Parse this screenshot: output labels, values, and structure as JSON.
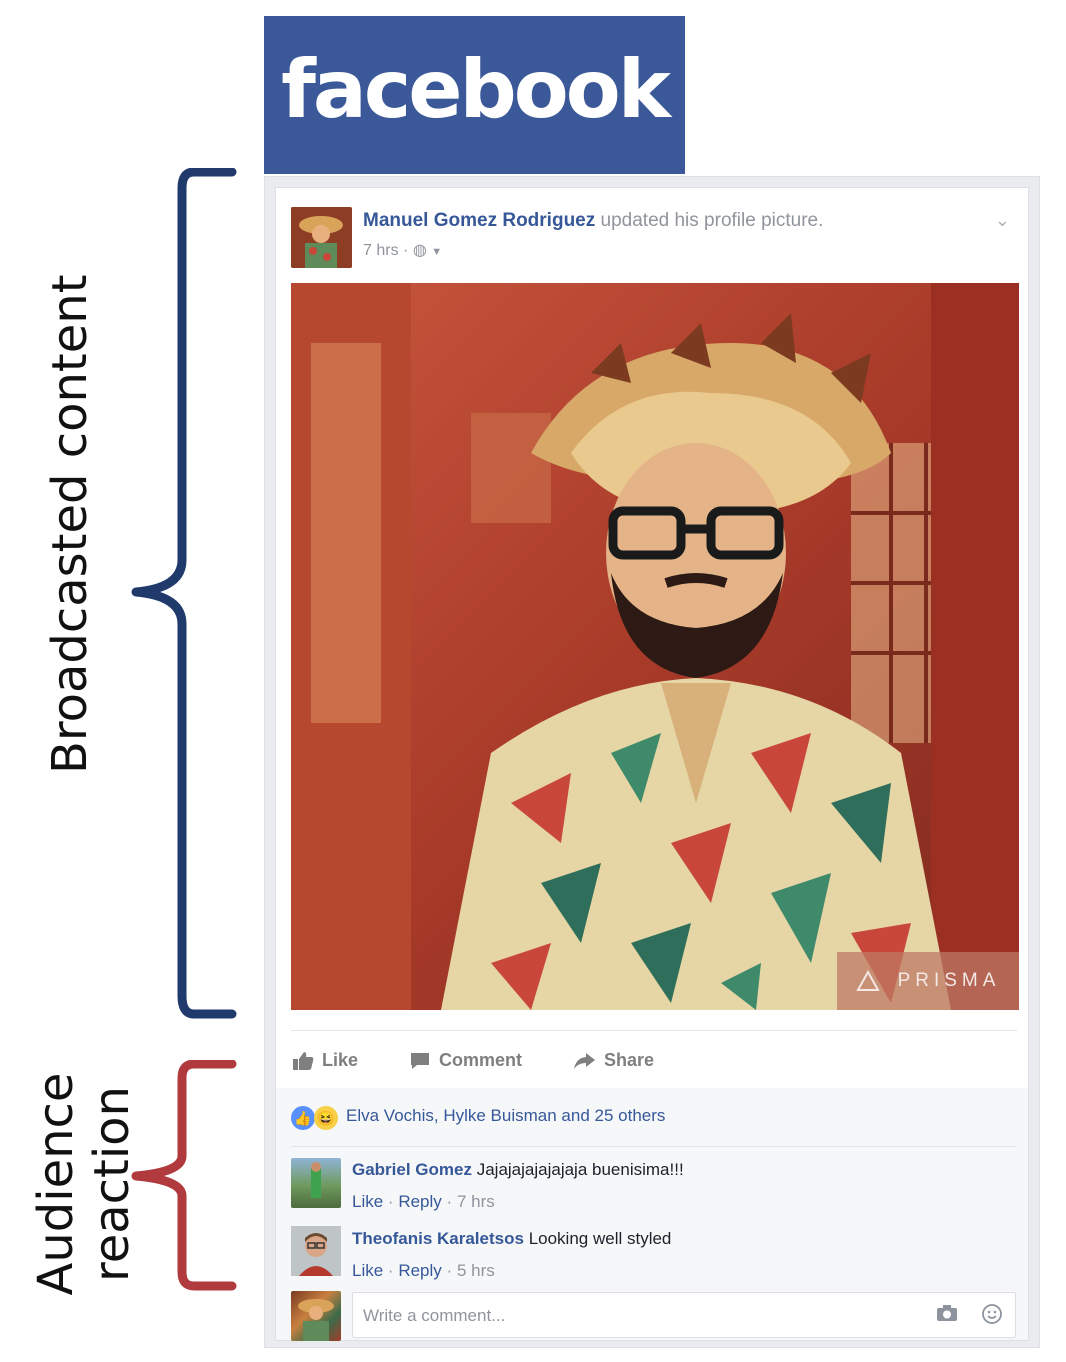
{
  "logo": {
    "text": "facebook",
    "color": "#3b5998"
  },
  "annotations": {
    "broadcast_label": "Broadcasted content",
    "broadcast_color": "#1f3a6b",
    "audience_label_line1": "Audience",
    "audience_label_line2": "reaction",
    "audience_color": "#b13a3e"
  },
  "post": {
    "author": "Manuel Gomez Rodriguez",
    "action_text": "updated his profile picture.",
    "time": "7 hrs",
    "privacy_icon": "globe-icon",
    "watermark": "PRISMA"
  },
  "actions": {
    "like": "Like",
    "comment": "Comment",
    "share": "Share"
  },
  "reactions": {
    "summary": "Elva Vochis, Hylke Buisman and 25 others",
    "icons": [
      "like-reaction-icon",
      "haha-reaction-icon"
    ]
  },
  "comments": [
    {
      "author": "Gabriel Gomez",
      "text": "Jajajajajajajaja buenisima!!!",
      "like": "Like",
      "reply": "Reply",
      "time": "7 hrs"
    },
    {
      "author": "Theofanis Karaletsos",
      "text": "Looking well styled",
      "like": "Like",
      "reply": "Reply",
      "time": "5 hrs"
    }
  ],
  "composer": {
    "placeholder": "Write a comment..."
  }
}
